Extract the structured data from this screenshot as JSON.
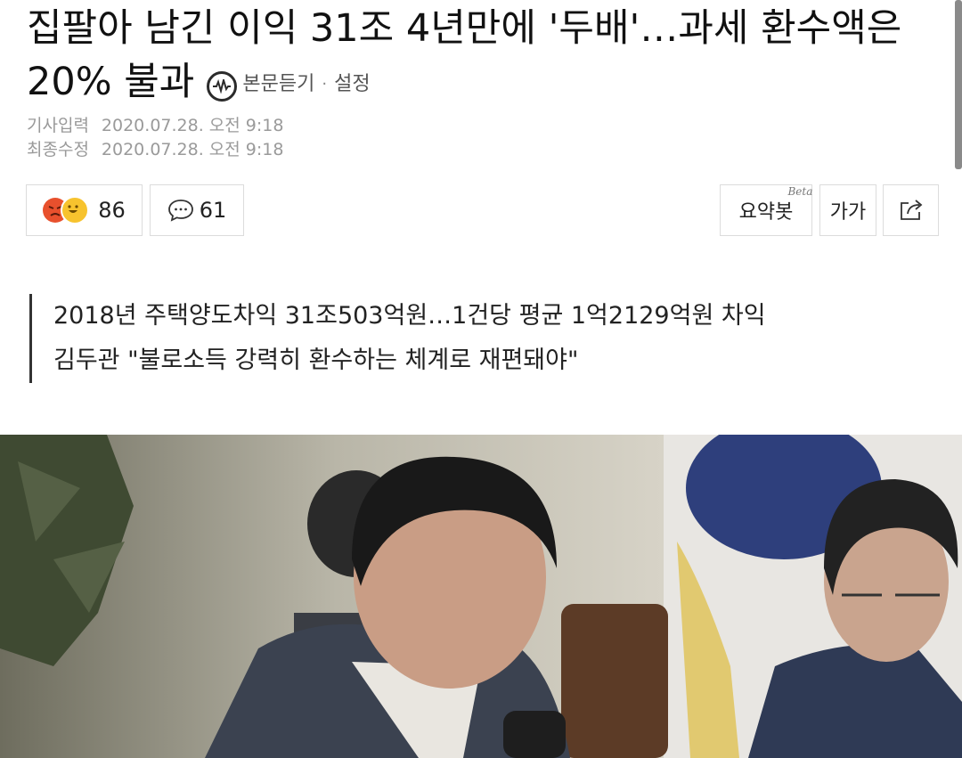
{
  "article": {
    "title": "집팔아 남긴 이익 31조 4년만에 '두배'…과세 환수액은 20% 불과",
    "listen_label": "본문듣기",
    "separator": "·",
    "settings_label": "설정"
  },
  "meta": {
    "published_label": "기사입력",
    "published_value": "2020.07.28. 오전 9:18",
    "modified_label": "최종수정",
    "modified_value": "2020.07.28. 오전 9:18"
  },
  "toolbar": {
    "reaction_count": "86",
    "comment_count": "61",
    "summary_label": "요약봇",
    "summary_badge": "Beta",
    "font_size_label": "가가"
  },
  "subtitle": {
    "line1": "2018년 주택양도차익 31조503억원…1건당 평균 1억2129억원 차익",
    "line2": "김두관 \"불로소득 강력히 환수하는 체계로 재편돼야\""
  },
  "colors": {
    "reaction_angry": "#e8502d",
    "reaction_happy": "#f7c32e",
    "border": "#dcdcdc",
    "meta_text": "#9a9a9a"
  },
  "icons": {
    "listen": "speaker-waveform-icon",
    "comment": "speech-bubble-icon",
    "share": "share-icon"
  }
}
